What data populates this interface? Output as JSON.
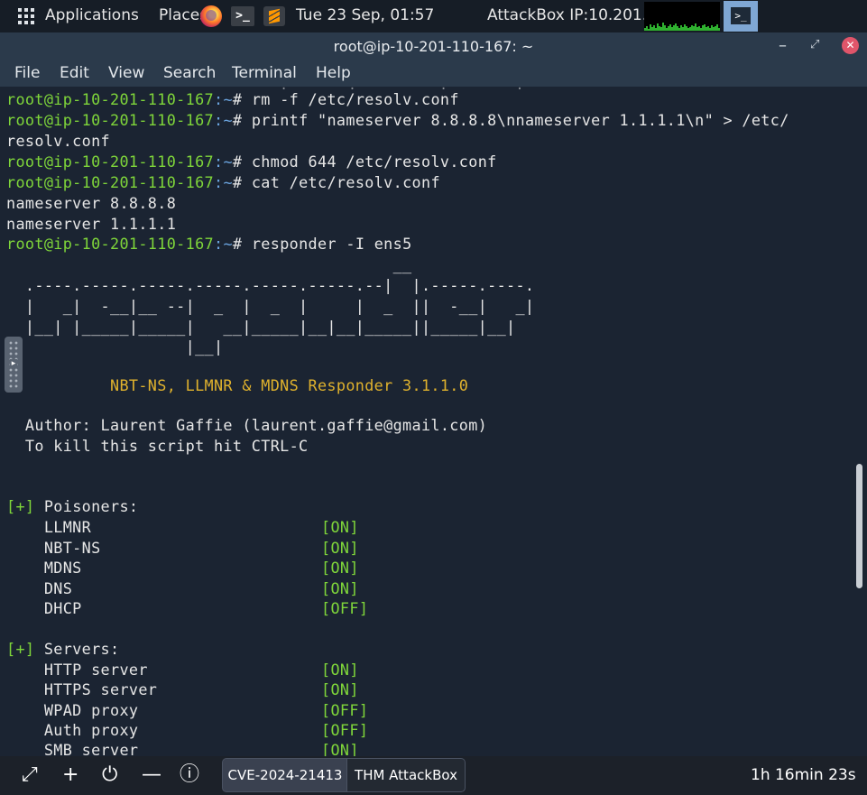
{
  "top_panel": {
    "applications_label": "Applications",
    "places_label": "Places",
    "terminal_launcher_glyph": ">_",
    "datetime": "Tue 23 Sep, 01:57",
    "ip_label": "AttackBox IP:10.201.110.167"
  },
  "window": {
    "title": "root@ip-10-201-110-167: ~",
    "minimize_glyph": "–",
    "maximize_glyph": "⤢",
    "close_glyph": "✕"
  },
  "menu": {
    "items": [
      "File",
      "Edit",
      "View",
      "Search",
      "Terminal",
      "Help"
    ]
  },
  "terminal": {
    "prompt_user": "root@ip-10-201-110-167",
    "prompt_path": ":~",
    "prompt_suffix": "# ",
    "commands": [
      "rm -f /etc/resolv.conf",
      "printf \"nameserver 8.8.8.8\\nnameserver 1.1.1.1\\n\" > /etc/",
      "chmod 644 /etc/resolv.conf",
      "cat /etc/resolv.conf",
      "responder -I ens5"
    ],
    "wrap_line": "resolv.conf",
    "output": [
      "nameserver 8.8.8.8",
      "nameserver 1.1.1.1"
    ],
    "banner": [
      "                                         __",
      "  .----.-----.-----.-----.-----.-----.--|  |.-----.----.",
      "  |   _|  -__|__ --|  _  |  _  |     |  _  ||  -__|   _|",
      "  |__| |_____|_____|   __|_____|__|__|_____||_____|__|",
      "                   |__|"
    ],
    "responder_title": "           NBT-NS, LLMNR & MDNS Responder 3.1.1.0",
    "author_line": "  Author: Laurent Gaffie (laurent.gaffie@gmail.com)",
    "kill_line": "  To kill this script hit CTRL-C",
    "poisoners_tag": "[+]",
    "poisoners_heading": " Poisoners:",
    "poisoners": [
      {
        "name": "    LLMNR",
        "status": "[ON]"
      },
      {
        "name": "    NBT-NS",
        "status": "[ON]"
      },
      {
        "name": "    MDNS",
        "status": "[ON]"
      },
      {
        "name": "    DNS",
        "status": "[ON]"
      },
      {
        "name": "    DHCP",
        "status": "[OFF]"
      }
    ],
    "servers_tag": "[+]",
    "servers_heading": " Servers:",
    "servers": [
      {
        "name": "    HTTP server",
        "status": "[ON]"
      },
      {
        "name": "    HTTPS server",
        "status": "[ON]"
      },
      {
        "name": "    WPAD proxy",
        "status": "[OFF]"
      },
      {
        "name": "    Auth proxy",
        "status": "[OFF]"
      },
      {
        "name": "    SMB server",
        "status": "[ON]"
      }
    ]
  },
  "bottom_bar": {
    "expand_icon": "⤢",
    "add_icon": "+",
    "power_icon": "⏻",
    "minimize_icon": "—",
    "info_icon": "ⓘ",
    "tabs": [
      "CVE-2024-21413",
      "THM AttackBox"
    ],
    "timer": "1h 16min 23s"
  },
  "colors": {
    "terminal_bg": "#1b2432",
    "prompt_green": "#7fd63a",
    "prompt_blue": "#6ba5e0",
    "banner_yellow": "#e0b22d"
  }
}
